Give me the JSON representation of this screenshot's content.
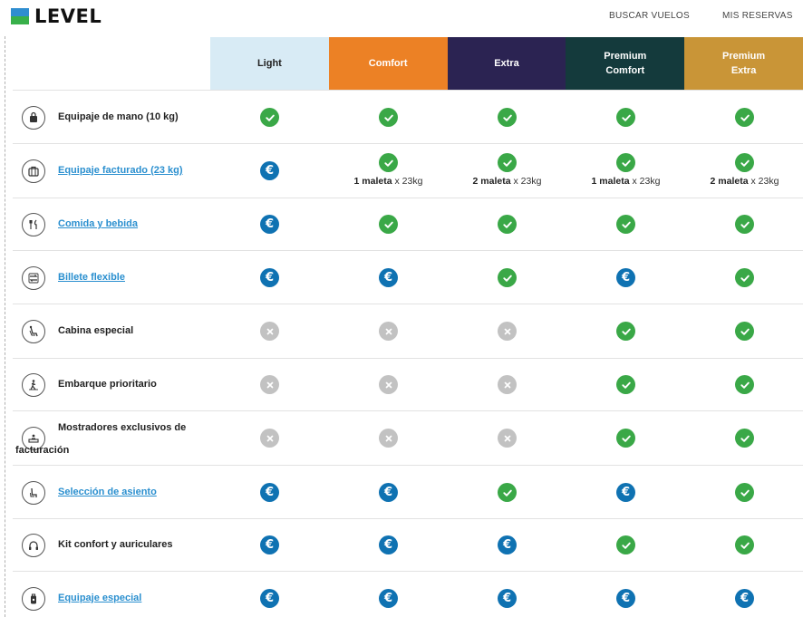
{
  "header": {
    "logo_text": "LEVEL",
    "nav": [
      "BUSCAR VUELOS",
      "MIS RESERVAS"
    ]
  },
  "colors": {
    "light": "#d8ebf5",
    "comfort": "#ec8125",
    "extra": "#2b2352",
    "premium_comfort": "#143a3c",
    "premium_extra": "#c99537",
    "included": "#3aa847",
    "paid": "#0f72b2",
    "not_available": "#c2c2c2",
    "link": "#2a8fcf"
  },
  "plans": [
    "Light",
    "Comfort",
    "Extra",
    "Premium\nComfort",
    "Premium\nExtra"
  ],
  "legend_icons": {
    "check": "check-icon",
    "euro": "euro-icon",
    "cross": "cross-icon"
  },
  "rows": [
    {
      "icon": "padlock-bag-icon",
      "label": "Equipaje de mano (10 kg)",
      "link": false,
      "values": [
        "check",
        "check",
        "check",
        "check",
        "check"
      ]
    },
    {
      "icon": "suitcase-icon",
      "label": "Equipaje facturado (23 kg)",
      "link": true,
      "values": [
        "euro",
        "check",
        "check",
        "check",
        "check"
      ],
      "notes": [
        null,
        {
          "qty": "1 maleta",
          "unit": " x 23kg"
        },
        {
          "qty": "2 maleta",
          "unit": " x 23kg"
        },
        {
          "qty": "1 maleta",
          "unit": " x 23kg"
        },
        {
          "qty": "2 maleta",
          "unit": " x 23kg"
        }
      ]
    },
    {
      "icon": "cutlery-icon",
      "label": "Comida y bebida",
      "link": true,
      "values": [
        "euro",
        "check",
        "check",
        "check",
        "check"
      ]
    },
    {
      "icon": "flexible-ticket-icon",
      "label": "Billete flexible",
      "link": true,
      "values": [
        "euro",
        "euro",
        "check",
        "euro",
        "check"
      ]
    },
    {
      "icon": "seat-cabin-icon",
      "label": "Cabina especial",
      "link": false,
      "values": [
        "cross",
        "cross",
        "cross",
        "check",
        "check"
      ]
    },
    {
      "icon": "priority-boarding-icon",
      "label": "Embarque prioritario",
      "link": false,
      "values": [
        "cross",
        "cross",
        "cross",
        "check",
        "check"
      ]
    },
    {
      "icon": "checkin-desk-icon",
      "label": "Mostradores exclusivos de facturación",
      "link": false,
      "values": [
        "cross",
        "cross",
        "cross",
        "check",
        "check"
      ]
    },
    {
      "icon": "seat-selection-icon",
      "label": "Selección de asiento",
      "link": true,
      "values": [
        "euro",
        "euro",
        "check",
        "euro",
        "check"
      ]
    },
    {
      "icon": "headphones-icon",
      "label": "Kit confort y auriculares",
      "link": false,
      "values": [
        "euro",
        "euro",
        "euro",
        "check",
        "check"
      ]
    },
    {
      "icon": "special-luggage-icon",
      "label": "Equipaje especial",
      "link": true,
      "values": [
        "euro",
        "euro",
        "euro",
        "euro",
        "euro"
      ]
    }
  ]
}
